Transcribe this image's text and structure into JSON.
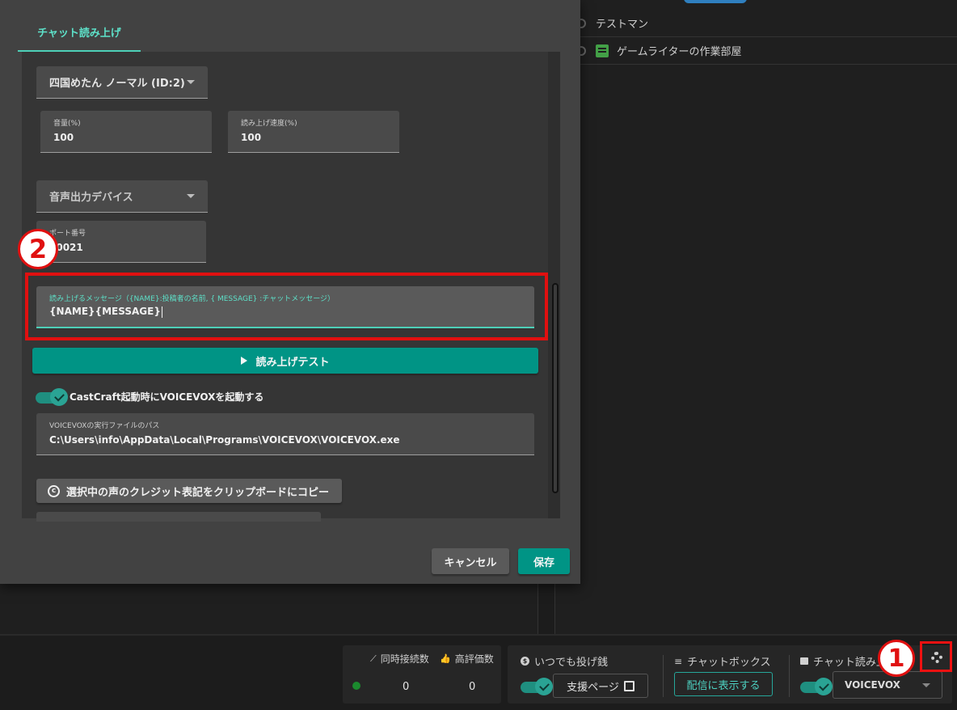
{
  "background": {
    "channel_list": [
      {
        "label": "テストマン",
        "icon": "circle-icon"
      },
      {
        "label": "ゲームライターの作業部屋",
        "icon": "document-icon"
      }
    ]
  },
  "dialog": {
    "tab_label": "チャット読み上げ",
    "voice_select": {
      "value": "四国めたん ノーマル (ID:2)"
    },
    "volume": {
      "label": "音量(%)",
      "value": "100"
    },
    "speed": {
      "label": "読み上げ速度(%)",
      "value": "100"
    },
    "output_device": {
      "placeholder": "音声出力デバイス"
    },
    "port": {
      "label": "ポート番号",
      "value": "50021"
    },
    "message_template": {
      "label": "読み上げるメッセージ（{NAME}:投稿者の名前, { MESSAGE} :チャットメッセージ）",
      "value": "{NAME}{MESSAGE}"
    },
    "test_button": "読み上げテスト",
    "auto_launch": {
      "label": "CastCraft起動時にVOICEVOXを起動する",
      "checked": true
    },
    "exe_path": {
      "label": "VOICEVOXの実行ファイルのパス",
      "value": "C:\\Users\\info\\AppData\\Local\\Programs\\VOICEVOX\\VOICEVOX.exe"
    },
    "copy_credit_button": "選択中の声のクレジット表記をクリップボードにコピー",
    "cancel_button": "キャンセル",
    "save_button": "保存"
  },
  "bottom_bar": {
    "concurrent_viewers": {
      "label": "同時接続数",
      "value": "0"
    },
    "likes": {
      "label": "高評価数",
      "value": "0"
    },
    "tip": {
      "label": "いつでも投げ銭",
      "button": "支援ページ",
      "enabled": true
    },
    "chat_box": {
      "label": "チャットボックス",
      "button": "配信に表示する"
    },
    "chat_reading": {
      "label": "チャット読み上げ",
      "select": "VOICEVOX",
      "enabled": true
    }
  },
  "annotations": {
    "marker_1": "1",
    "marker_2": "2"
  },
  "colors": {
    "accent": "#009485",
    "accent_text": "#5de0c8",
    "highlight": "#e01010"
  }
}
